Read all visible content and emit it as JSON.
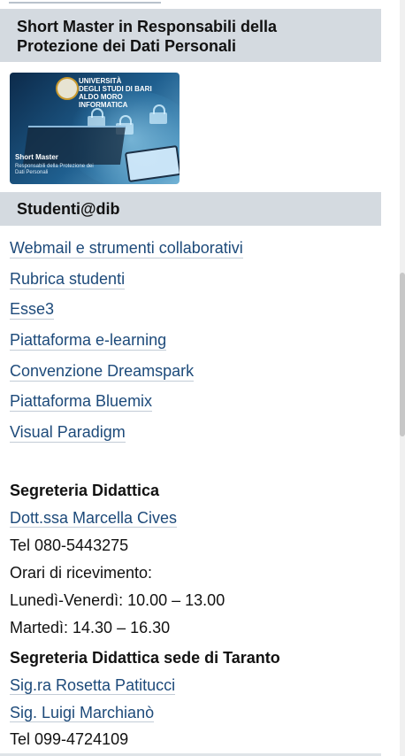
{
  "short_master": {
    "heading": "Short Master in Responsabili della Protezione dei Dati Personali",
    "banner": {
      "university_line1": "UNIVERSITÀ",
      "university_line2": "DEGLI STUDI DI BARI",
      "university_line3": "ALDO MORO",
      "university_line4": "INFORMATICA",
      "title": "Short Master",
      "subtitle": "Responsabili della Protezione dei Dati Personali"
    }
  },
  "studenti": {
    "heading": "Studenti@dib",
    "links": [
      "Webmail e strumenti collaborativi",
      "Rubrica studenti",
      "Esse3",
      "Piattaforma e-learning",
      "Convenzione Dreamspark",
      "Piattaforma Bluemix",
      "Visual Paradigm"
    ]
  },
  "segreteria": {
    "heading": "Segreteria Didattica",
    "contact": "Dott.ssa Marcella Cives",
    "tel": "Tel 080-5443275",
    "orari_label": "Orari di ricevimento:",
    "orari_1": "Lunedì-Venerdì: 10.00 – 13.00",
    "orari_2": "Martedì: 14.30 – 16.30"
  },
  "segreteria_taranto": {
    "heading": "Segreteria Didattica sede di Taranto",
    "contact_1": "Sig.ra Rosetta Patitucci",
    "contact_2": "Sig. Luigi Marchianò",
    "tel": "Tel 099-4724109"
  }
}
